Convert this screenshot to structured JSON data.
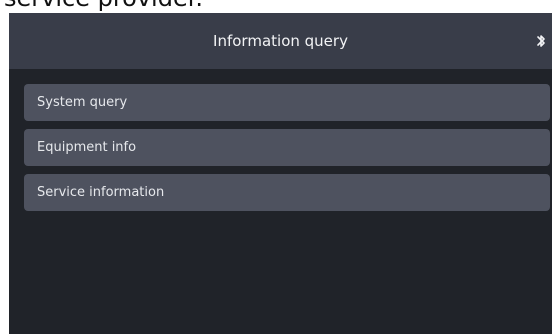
{
  "caption": {
    "text": "service provider."
  },
  "header": {
    "title": "Information query",
    "status_icon": "bluetooth-icon"
  },
  "menu": {
    "items": [
      {
        "label": "System query"
      },
      {
        "label": "Equipment info"
      },
      {
        "label": "Service information"
      }
    ]
  },
  "colors": {
    "background": "#202329",
    "header": "#393d49",
    "item": "#4e525f",
    "text": "#e6e8ec"
  }
}
